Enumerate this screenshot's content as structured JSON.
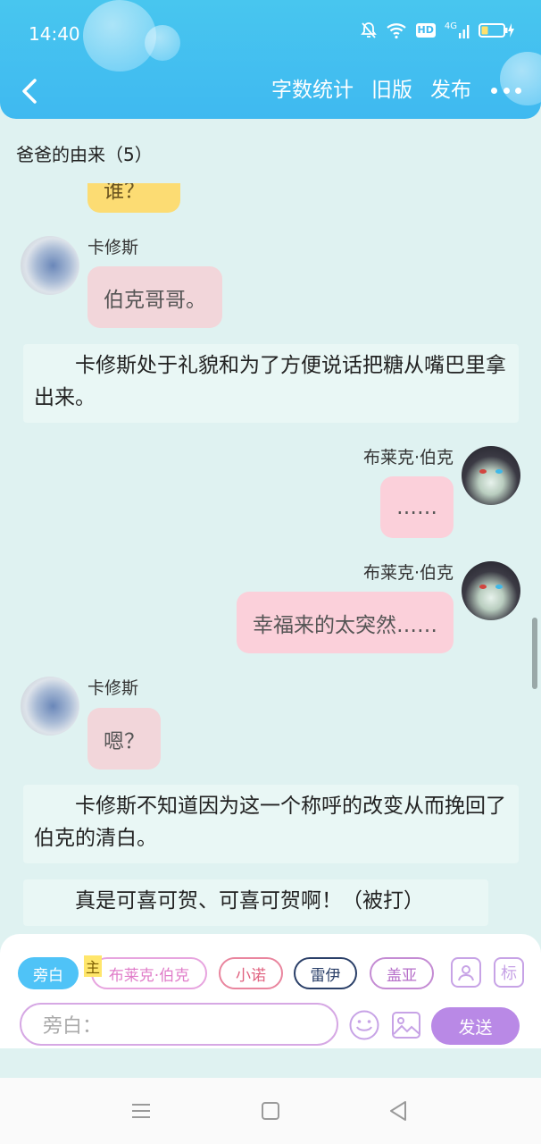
{
  "status": {
    "time": "14:40",
    "net_label": "HD",
    "signal_label": "4G"
  },
  "nav": {
    "word_count": "字数统计",
    "old_version": "旧版",
    "publish": "发布"
  },
  "chapter": {
    "title": "爸爸的由来（5）"
  },
  "messages": {
    "partial_top": "他是谁？",
    "m1_speaker": "卡修斯",
    "m1_text": "伯克哥哥。",
    "n1_text": "卡修斯处于礼貌和为了方便说话把糖从嘴巴里拿出来。",
    "m2_speaker": "布莱克·伯克",
    "m2_text": "……",
    "m3_speaker": "布莱克·伯克",
    "m3_text": "幸福来的太突然……",
    "m4_speaker": "卡修斯",
    "m4_text": "嗯？",
    "n2_text": "卡修斯不知道因为这一个称呼的改变从而挽回了伯克的清白。",
    "n3_text": "真是可喜可贺、可喜可贺啊！（被打）"
  },
  "composer": {
    "chips": [
      "旁白",
      "布莱克·伯克",
      "小诺",
      "雷伊",
      "盖亚"
    ],
    "main_tag": "主",
    "tag_button": "标",
    "placeholder": "旁白：",
    "send": "发送"
  },
  "colors": {
    "header": "#48c6ef",
    "background": "#dff2f1",
    "send": "#b989e6",
    "narration_chip": "#4fc3f7"
  }
}
